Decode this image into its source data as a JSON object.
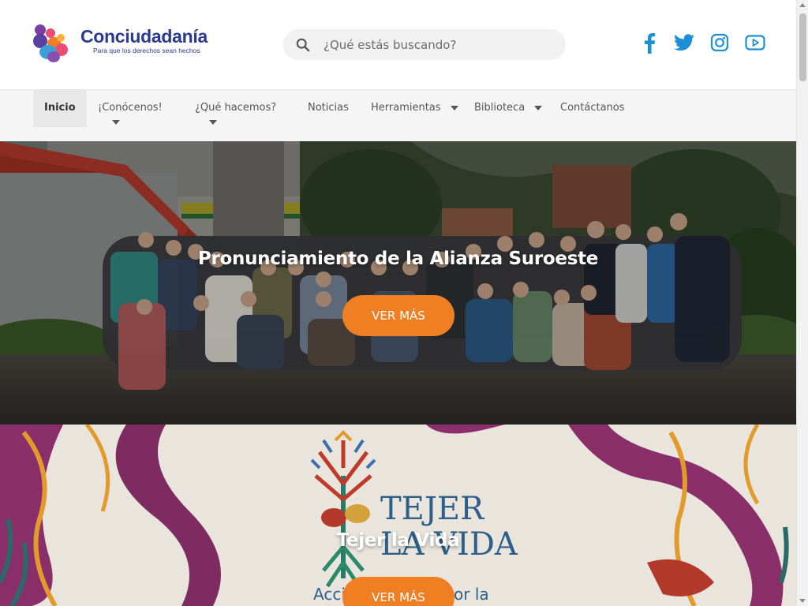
{
  "brand": {
    "name": "Conciudadanía",
    "tagline": "Para que los derechos sean hechos",
    "colors": {
      "primary": "#2b3a91",
      "accent": "#f07f24",
      "social": "#1e8fd6"
    }
  },
  "search": {
    "placeholder": "¿Qué estás buscando?",
    "icon": "search-icon"
  },
  "social": [
    {
      "name": "facebook-icon"
    },
    {
      "name": "twitter-icon"
    },
    {
      "name": "instagram-icon"
    },
    {
      "name": "youtube-icon"
    }
  ],
  "nav": {
    "items": [
      {
        "label": "Inicio",
        "active": true,
        "dropdown": false
      },
      {
        "label": "¡Conócenos!",
        "active": false,
        "dropdown": true
      },
      {
        "label": "¿Qué hacemos?",
        "active": false,
        "dropdown": true
      },
      {
        "label": "Noticias",
        "active": false,
        "dropdown": false
      },
      {
        "label": "Herramientas",
        "active": false,
        "dropdown": true
      },
      {
        "label": "Biblioteca",
        "active": false,
        "dropdown": true
      },
      {
        "label": "Contáctanos",
        "active": false,
        "dropdown": false
      }
    ]
  },
  "slides": [
    {
      "title": "Pronunciamiento de la Alianza Suroeste",
      "button": "VER MÁS"
    },
    {
      "title": "Tejer la Vida",
      "button": "VER MÁS",
      "artwork_text": [
        "TEJER",
        "LA VIDA",
        "Acci",
        "or la"
      ]
    }
  ]
}
